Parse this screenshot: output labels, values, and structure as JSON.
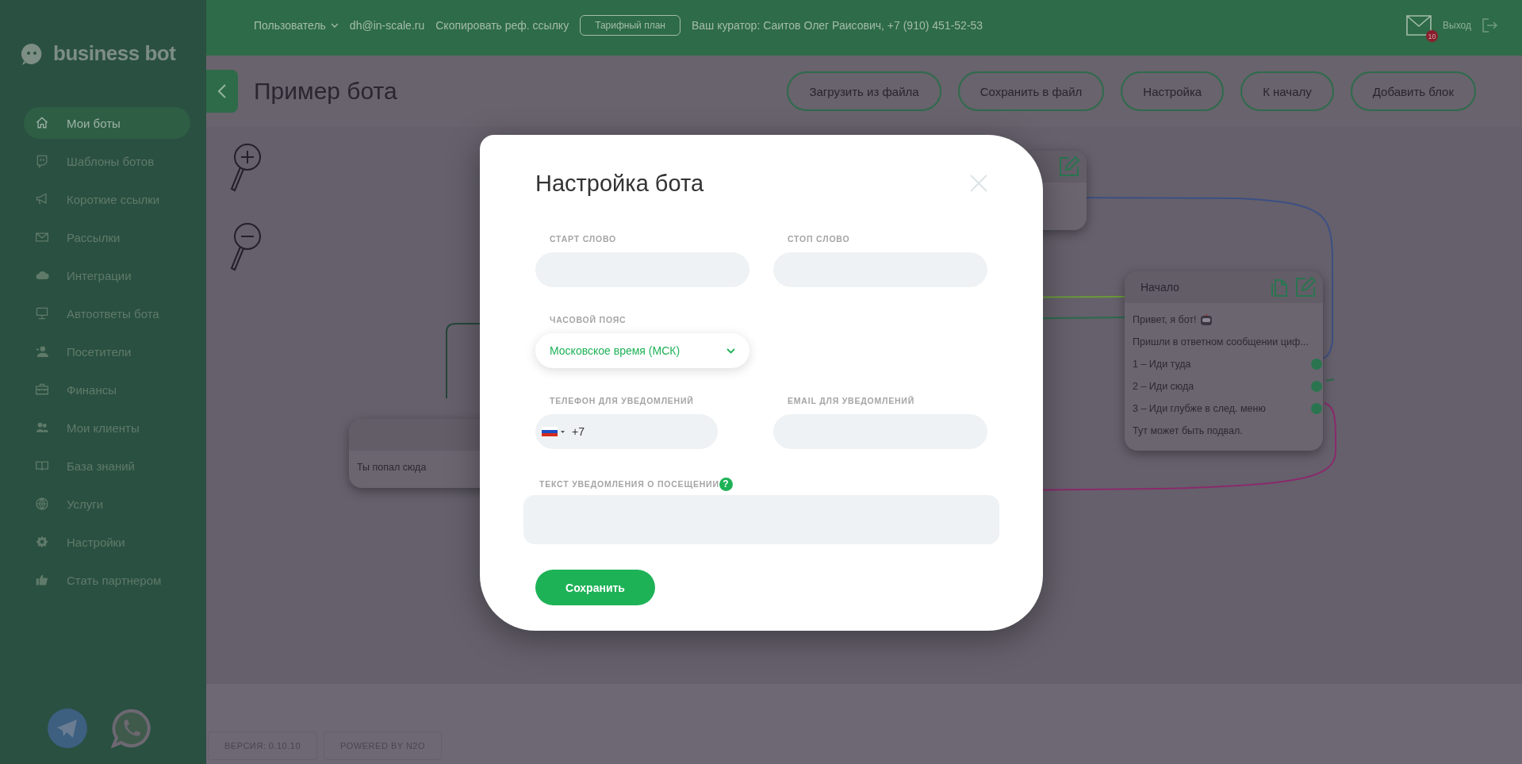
{
  "logo": {
    "text": "business bot"
  },
  "topbar": {
    "user_menu": "Пользователь",
    "email": "dh@in-scale.ru",
    "ref_link": "Скопировать реф. ссылку",
    "plan_button": "Тарифный план",
    "curator": "Ваш куратор: Саитов Олег Раисович, +7 (910) 451-52-53",
    "mail_badge": "10",
    "logout": "Выход"
  },
  "sidebar": {
    "items": [
      {
        "label": "Мои боты",
        "selected": true
      },
      {
        "label": "Шаблоны ботов",
        "selected": false
      },
      {
        "label": "Короткие ссылки",
        "selected": false
      },
      {
        "label": "Рассылки",
        "selected": false
      },
      {
        "label": "Интеграции",
        "selected": false
      },
      {
        "label": "Автоответы бота",
        "selected": false
      },
      {
        "label": "Посетители",
        "selected": false
      },
      {
        "label": "Финансы",
        "selected": false
      },
      {
        "label": "Мои клиенты",
        "selected": false
      },
      {
        "label": "База знаний",
        "selected": false
      },
      {
        "label": "Услуги",
        "selected": false
      },
      {
        "label": "Настройки",
        "selected": false
      },
      {
        "label": "Стать партнером",
        "selected": false
      }
    ]
  },
  "header": {
    "title": "Пример бота",
    "buttons": [
      "Загрузить из файла",
      "Сохранить в файл",
      "Настройка",
      "К началу",
      "Добавить блок"
    ]
  },
  "canvas": {
    "nodes": [
      {
        "kind": "block"
      },
      {
        "kind": "block",
        "lines": [
          {
            "text": "Ты попал сюда",
            "kind": "text"
          }
        ]
      },
      {
        "kind": "block",
        "title": "Начало",
        "lines": [
          {
            "text": "Привет, я бот!",
            "kind": "text"
          },
          {
            "text": "Пришли в ответном сообщении циф...",
            "kind": "text"
          },
          {
            "text": "1 – Иди туда",
            "kind": "option"
          },
          {
            "text": "2 – Иди сюда",
            "kind": "option"
          },
          {
            "text": "3 – Иди глубже в след. меню",
            "kind": "option"
          },
          {
            "text": "Тут может быть подвал.",
            "kind": "text"
          }
        ]
      }
    ]
  },
  "footer": {
    "badges": [
      "ВЕРСИЯ: 0.10.10",
      "POWERED BY N2O"
    ]
  },
  "modal": {
    "title": "Настройка бота",
    "fields": [
      {
        "label": "СТАРТ СЛОВО",
        "kind": "text"
      },
      {
        "label": "СТОП СЛОВО",
        "kind": "text"
      },
      {
        "label": "ЧАСОВОЙ ПОЯС",
        "kind": "select",
        "value": "Московское время (МСК)"
      },
      {
        "label": "ТЕЛЕФОН ДЛЯ УВЕДОМЛЕНИЙ",
        "kind": "phone",
        "value": "+7"
      },
      {
        "label": "EMAIL ДЛЯ УВЕДОМЛЕНИЙ",
        "kind": "text"
      },
      {
        "label": "ТЕКСТ УВЕДОМЛЕНИЯ О ПОСЕЩЕНИИ",
        "kind": "textarea",
        "help": "?"
      }
    ],
    "save_button": "Сохранить"
  }
}
